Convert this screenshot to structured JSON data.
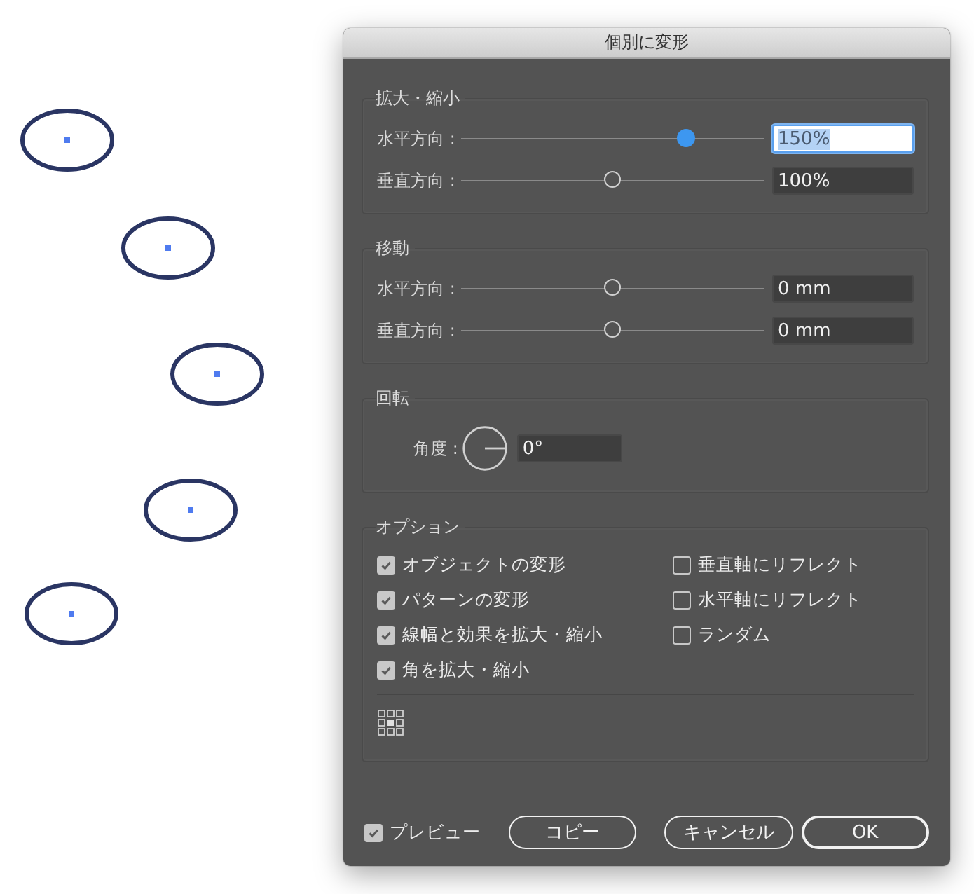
{
  "dialog": {
    "title": "個別に変形",
    "scale": {
      "heading": "拡大・縮小",
      "rows": [
        {
          "label": "水平方向 :",
          "level": 0.74,
          "value": "150%",
          "focused": true
        },
        {
          "label": "垂直方向 :",
          "level": 0.5,
          "value": "100%",
          "focused": false
        }
      ]
    },
    "move": {
      "heading": "移動",
      "rows": [
        {
          "label": "水平方向 :",
          "level": 0.5,
          "value": "0 mm",
          "focused": false
        },
        {
          "label": "垂直方向 :",
          "level": 0.5,
          "value": "0 mm",
          "focused": false
        }
      ]
    },
    "rotate": {
      "heading": "回転",
      "label": "角度 :",
      "value": "0°"
    },
    "options": {
      "heading": "オプション",
      "left": [
        {
          "label": "オブジェクトの変形",
          "checked": true
        },
        {
          "label": "パターンの変形",
          "checked": true
        },
        {
          "label": "線幅と効果を拡大・縮小",
          "checked": true
        },
        {
          "label": "角を拡大・縮小",
          "checked": true
        }
      ],
      "right": [
        {
          "label": "垂直軸にリフレクト",
          "checked": false
        },
        {
          "label": "水平軸にリフレクト",
          "checked": false
        },
        {
          "label": "ランダム",
          "checked": false
        }
      ]
    },
    "preview": {
      "label": "プレビュー",
      "checked": true
    },
    "buttons": [
      {
        "label": "コピー",
        "default": false
      },
      {
        "label": "キャンセル",
        "default": false
      },
      {
        "label": "OK",
        "default": true
      }
    ]
  }
}
